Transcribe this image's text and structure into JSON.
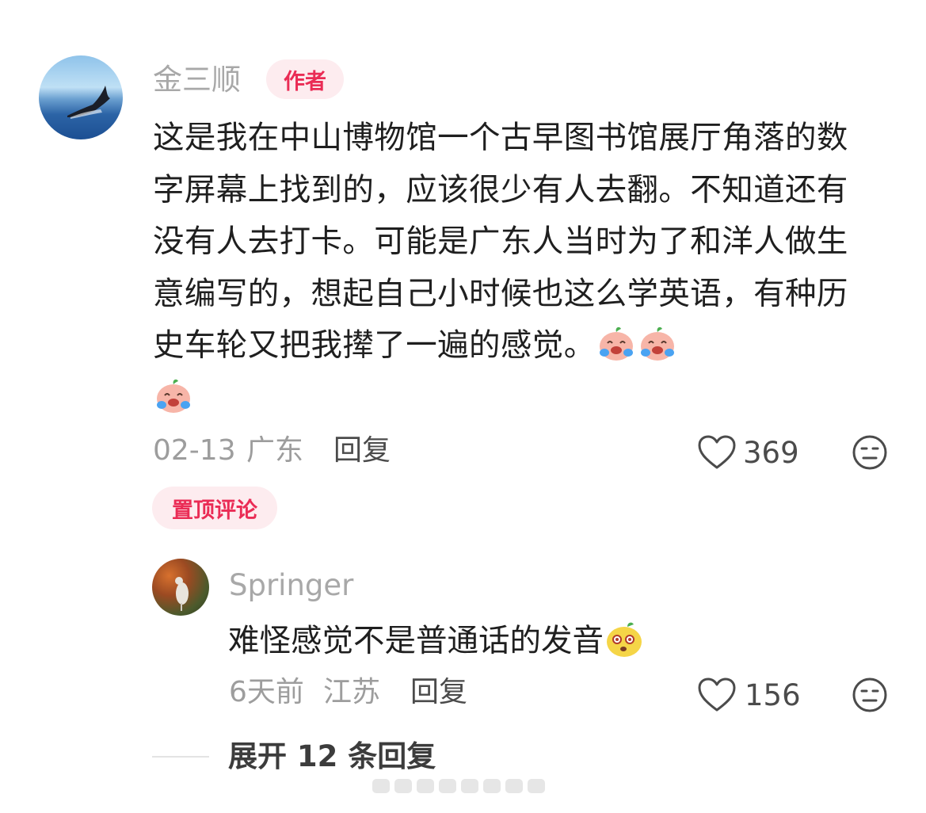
{
  "main_comment": {
    "username": "金三顺",
    "author_badge": "作者",
    "text": "这是我在中山博物馆一个古早图书馆展厅角落的数字屏幕上找到的，应该很少有人去翻。不知道还有没有人去打卡。可能是广东人当时为了和洋人做生意编写的，想起自己小时候也这么学英语，有种历史车轮又把我撵了一遍的感觉。",
    "emojis": [
      "crying-laughing-emoji",
      "crying-laughing-emoji",
      "crying-laughing-emoji"
    ],
    "date": "02-13",
    "location": "广东",
    "reply_label": "回复",
    "likes": "369"
  },
  "pinned_badge": "置顶评论",
  "reply_comment": {
    "username": "Springer",
    "text": "难怪感觉不是普通话的发音",
    "emoji": "surprised-face-emoji",
    "date": "6天前",
    "location": "江苏",
    "reply_label": "回复",
    "likes": "156"
  },
  "expand_label": "展开 12 条回复",
  "colors": {
    "accent": "#ea2c55",
    "badge_bg": "#fdecef",
    "muted": "#a8a8a8"
  }
}
